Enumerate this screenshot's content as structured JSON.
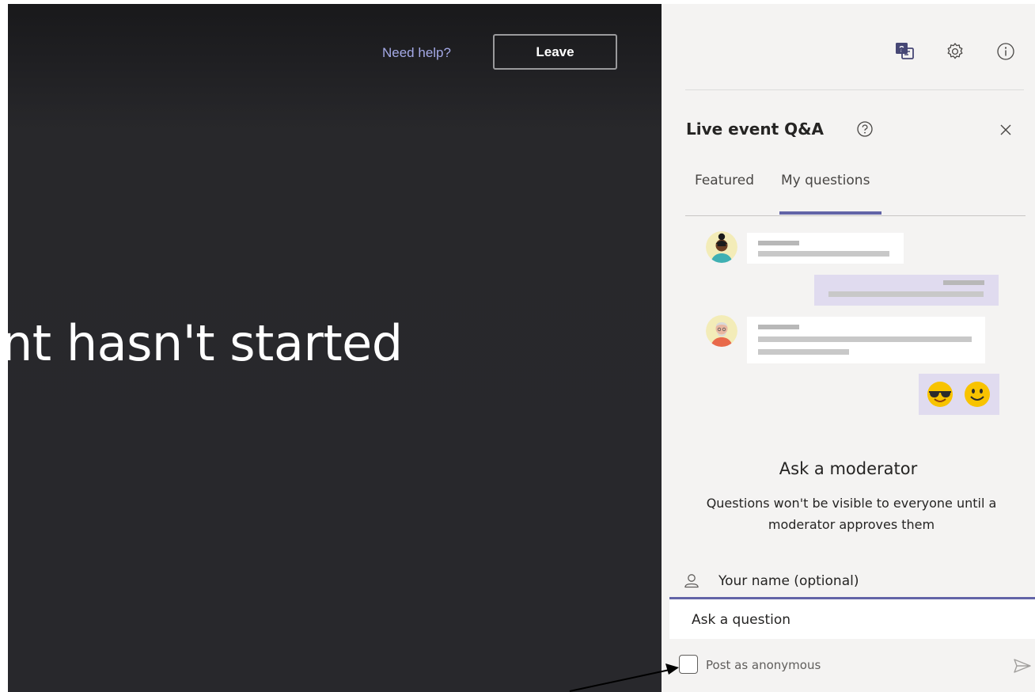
{
  "stage": {
    "help_link": "Need help?",
    "leave_button": "Leave",
    "message": "nt hasn't started"
  },
  "toolbar": {
    "icons": [
      "qa-icon",
      "gear-icon",
      "info-icon"
    ]
  },
  "qa": {
    "title": "Live event Q&A",
    "tabs": [
      {
        "label": "Featured",
        "selected": false
      },
      {
        "label": "My questions",
        "selected": true
      }
    ],
    "ask": {
      "heading": "Ask a moderator",
      "description": "Questions won't be visible to everyone until a moderator approves them"
    },
    "name_field": {
      "placeholder": "Your name (optional)"
    },
    "question_field": {
      "placeholder": "Ask a question"
    },
    "anonymous": {
      "label": "Post as anonymous",
      "checked": false
    }
  },
  "colors": {
    "accent": "#6264a7",
    "stage_bg": "#28282c",
    "panel_bg": "#f4f3f2",
    "self_bubble": "#e0dbef"
  }
}
